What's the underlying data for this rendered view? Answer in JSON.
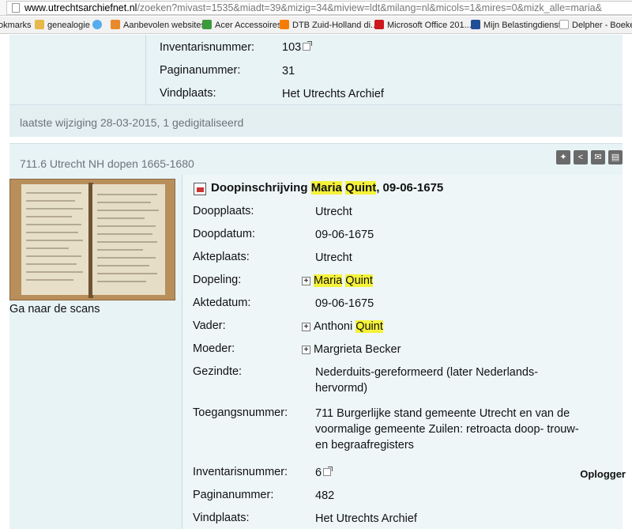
{
  "browser": {
    "url_host": "www.utrechtsarchiefnet.nl",
    "url_rest": "/zoeken?mivast=1535&miadt=39&mizig=34&miview=ldt&milang=nl&micols=1&mires=0&mizk_alle=maria&",
    "bookmarks": [
      {
        "label": "okmarks",
        "icon": "bookmark-star",
        "color": "#d8a63a"
      },
      {
        "label": "genealogie",
        "icon": "folder",
        "color": "#e6b84a"
      },
      {
        "label": "",
        "icon": "twitter-bird",
        "color": "#55acee"
      },
      {
        "label": "Aanbevolen websites",
        "icon": "suggested-sites",
        "color": "#e8892b"
      },
      {
        "label": "Acer Accessoires",
        "icon": "acer",
        "color": "#3c9a3c"
      },
      {
        "label": "DTB Zuid-Holland di...",
        "icon": "blogger",
        "color": "#f57d00"
      },
      {
        "label": "Microsoft Office 201...",
        "icon": "youtube",
        "color": "#cc181e"
      },
      {
        "label": "Mijn Belastingdienst",
        "icon": "belastingdienst",
        "color": "#1f4e96"
      },
      {
        "label": "Delpher - Boeken I",
        "icon": "page",
        "color": "#aaaaaa"
      }
    ]
  },
  "record1": {
    "rows": [
      {
        "label": "Inventarisnummer:",
        "value": "103"
      },
      {
        "label": "Paginanummer:",
        "value": "31"
      },
      {
        "label": "Vindplaats:",
        "value": "Het Utrechts Archief"
      }
    ],
    "footer": "laatste wijziging 28-03-2015,  1 gedigitaliseerd"
  },
  "record2": {
    "source_title": "711.6 Utrecht NH dopen 1665-1680",
    "scans_link": "Ga naar de scans",
    "title_prefix": "Doopinschrijving ",
    "title_first": "Maria",
    "title_last": "Quint",
    "title_suffix": ", 09-06-1675",
    "rows": {
      "doopplaats": {
        "label": "Doopplaats:",
        "value": "Utrecht"
      },
      "doopdatum": {
        "label": "Doopdatum:",
        "value": "09-06-1675"
      },
      "akteplaats": {
        "label": "Akteplaats:",
        "value": "Utrecht"
      },
      "dopeling": {
        "label": "Dopeling:",
        "first": "Maria",
        "last": "Quint"
      },
      "aktedatum": {
        "label": "Aktedatum:",
        "value": "09-06-1675"
      },
      "vader": {
        "label": "Vader:",
        "first": "Anthoni ",
        "last": "Quint"
      },
      "moeder": {
        "label": "Moeder:",
        "value": "Margrieta Becker"
      },
      "gezindte": {
        "label": "Gezindte:",
        "line1": "Nederduits-gereformeerd (later Nederlands-",
        "line2": "hervormd)"
      },
      "toegang": {
        "label": "Toegangsnummer:",
        "line1": "711 Burgerlijke stand gemeente Utrecht en van de",
        "line2": "voormalige gemeente Zuilen: retroacta doop- trouw-",
        "line3": "en begraafregisters"
      },
      "inventaris": {
        "label": "Inventarisnummer:",
        "value": "6"
      },
      "pagina": {
        "label": "Paginanummer:",
        "value": "482"
      },
      "vindplaats": {
        "label": "Vindplaats:",
        "value": "Het Utrechts Archief"
      }
    },
    "oplogger": "Oplogger",
    "highlight_color": "#f5f23a"
  }
}
